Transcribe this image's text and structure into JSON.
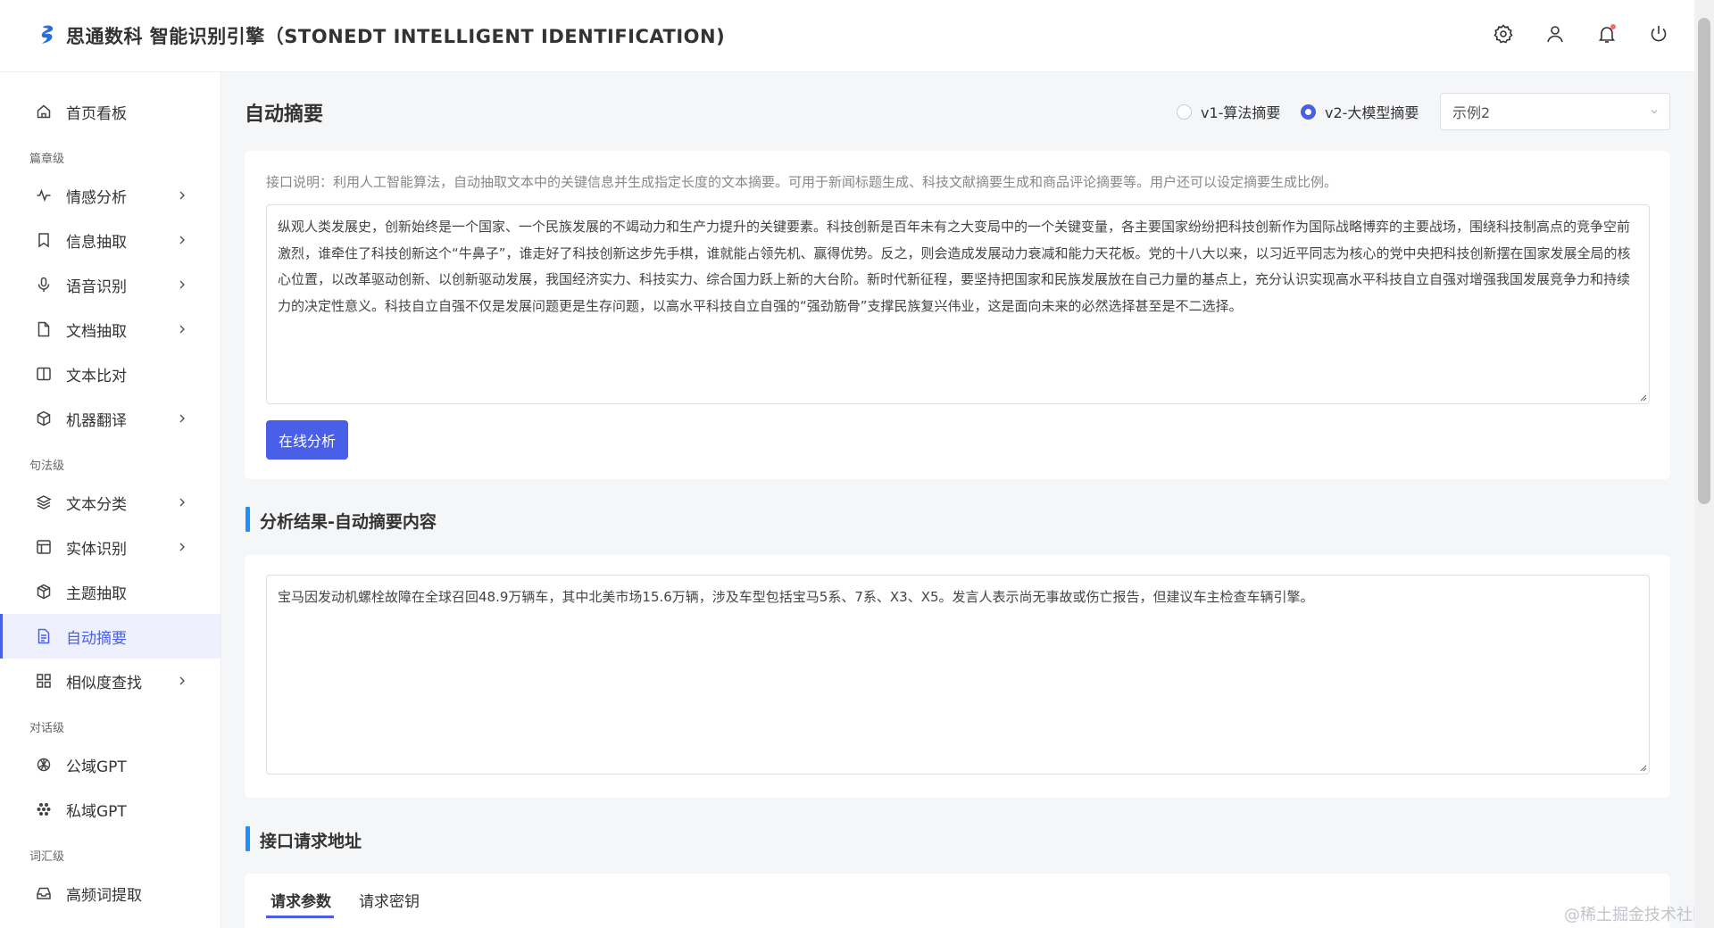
{
  "header": {
    "title": "思通数科 智能识别引擎（STONEDT INTELLIGENT IDENTIFICATION)",
    "icons": [
      "settings-icon",
      "user-icon",
      "bell-icon",
      "power-icon"
    ]
  },
  "sidebar": {
    "home": "首页看板",
    "groups": {
      "article": "篇章级",
      "sentence": "句法级",
      "dialog": "对话级",
      "vocab": "词汇级"
    },
    "items": {
      "sentiment": "情感分析",
      "info_extract": "信息抽取",
      "speech": "语音识别",
      "doc_extract": "文档抽取",
      "text_compare": "文本比对",
      "translate": "机器翻译",
      "classify": "文本分类",
      "entity": "实体识别",
      "topic": "主题抽取",
      "summary": "自动摘要",
      "similarity": "相似度查找",
      "public_gpt": "公域GPT",
      "private_gpt": "私域GPT",
      "keywords": "高频词提取"
    },
    "active": "自动摘要"
  },
  "main": {
    "title": "自动摘要",
    "radio_v1": "v1-算法摘要",
    "radio_v2": "v2-大模型摘要",
    "selected_version": "v2-大模型摘要",
    "example_select": "示例2",
    "description": "接口说明：利用人工智能算法，自动抽取文本中的关键信息并生成指定长度的文本摘要。可用于新闻标题生成、科技文献摘要生成和商品评论摘要等。用户还可以设定摘要生成比例。",
    "input_text": "纵观人类发展史，创新始终是一个国家、一个民族发展的不竭动力和生产力提升的关键要素。科技创新是百年未有之大变局中的一个关键变量，各主要国家纷纷把科技创新作为国际战略博弈的主要战场，围绕科技制高点的竞争空前激烈，谁牵住了科技创新这个“牛鼻子”，谁走好了科技创新这步先手棋，谁就能占领先机、赢得优势。反之，则会造成发展动力衰减和能力天花板。党的十八大以来，以习近平同志为核心的党中央把科技创新摆在国家发展全局的核心位置，以改革驱动创新、以创新驱动发展，我国经济实力、科技实力、综合国力跃上新的大台阶。新时代新征程，要坚持把国家和民族发展放在自己力量的基点上，充分认识实现高水平科技自立自强对增强我国发展竞争力和持续力的决定性意义。科技自立自强不仅是发展问题更是生存问题，以高水平科技自立自强的“强劲筋骨”支撑民族复兴伟业，这是面向未来的必然选择甚至是不二选择。",
    "analyze_button": "在线分析",
    "result_title": "分析结果-自动摘要内容",
    "result_text": "宝马因发动机螺栓故障在全球召回48.9万辆车，其中北美市场15.6万辆，涉及车型包括宝马5系、7系、X3、X5。发言人表示尚无事故或伤亡报告，但建议车主检查车辆引擎。",
    "api_title": "接口请求地址",
    "tabs": [
      "请求参数",
      "请求密钥"
    ],
    "active_tab": "请求参数"
  },
  "watermark": "@稀土掘金技术社区",
  "colors": {
    "accent": "#4a5fe8",
    "section_bar": "#1e90ff",
    "active_bg": "#eef1fd"
  }
}
